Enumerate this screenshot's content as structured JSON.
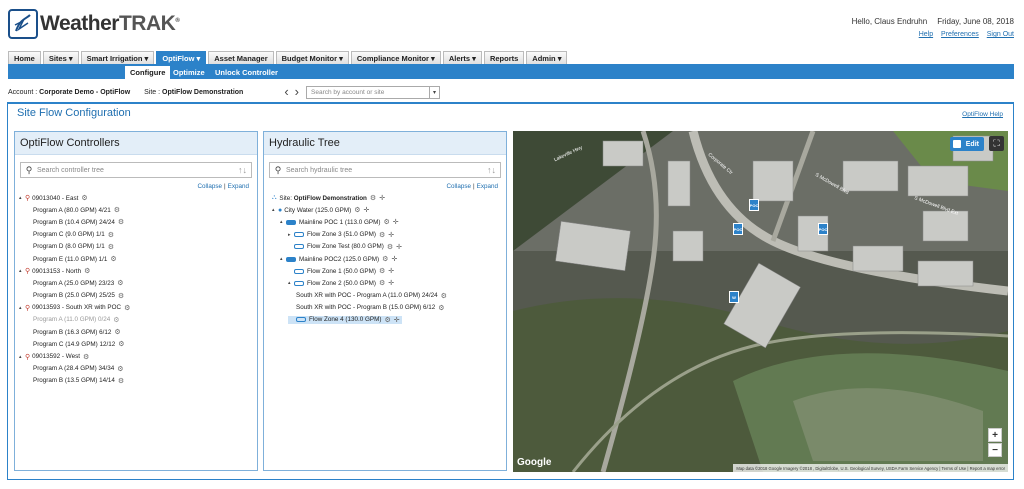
{
  "app": {
    "logo_text_a": "Weather",
    "logo_text_b": "TRAK",
    "logo_reg": "®"
  },
  "header": {
    "greeting": "Hello, Claus Endruhn",
    "date": "Friday, June 08, 2018",
    "links": [
      "Help",
      "Preferences",
      "Sign Out"
    ]
  },
  "nav": {
    "tabs": [
      "Home",
      "Sites ▾",
      "Smart Irrigation ▾",
      "OptiFlow ▾",
      "Asset Manager",
      "Budget Monitor ▾",
      "Compliance Monitor ▾",
      "Alerts ▾",
      "Reports",
      "Admin ▾"
    ],
    "active_index": 3
  },
  "subnav": {
    "items": [
      "Configure",
      "Optimize",
      "Unlock Controller"
    ],
    "active_index": 0
  },
  "account": {
    "label": "Account :",
    "value": "Corporate Demo - OptiFlow",
    "site_label": "Site :",
    "site_value": "OptiFlow Demonstration",
    "search_placeholder": "Search by account or site"
  },
  "page": {
    "title": "Site Flow Configuration",
    "help": "OptiFlow Help"
  },
  "controllers": {
    "title": "OptiFlow Controllers",
    "search_placeholder": "Search controller tree",
    "collapse": "Collapse",
    "expand": "Expand",
    "rows": [
      {
        "text": "09013040 - East",
        "level": 0
      },
      {
        "text": "Program A (80.0 GPM) 4/21",
        "level": 1
      },
      {
        "text": "Program B (10.4 GPM) 24/24",
        "level": 1
      },
      {
        "text": "Program C (9.0 GPM) 1/1",
        "level": 1
      },
      {
        "text": "Program D (8.0 GPM) 1/1",
        "level": 1
      },
      {
        "text": "Program E (11.0 GPM) 1/1",
        "level": 1
      },
      {
        "text": "09013153 - North",
        "level": 0
      },
      {
        "text": "Program A (25.0 GPM) 23/23",
        "level": 1
      },
      {
        "text": "Program B (25.0 GPM) 25/25",
        "level": 1
      },
      {
        "text": "09013593 - South XR with POC",
        "level": 0
      },
      {
        "text": "Program A (11.0 GPM) 0/24",
        "level": 1,
        "disabled": true
      },
      {
        "text": "Program B (16.3 GPM) 6/12",
        "level": 1
      },
      {
        "text": "Program C (14.9 GPM) 12/12",
        "level": 1
      },
      {
        "text": "09013592 - West",
        "level": 0
      },
      {
        "text": "Program A (28.4 GPM) 34/34",
        "level": 1
      },
      {
        "text": "Program B (13.5 GPM) 14/14",
        "level": 1
      }
    ]
  },
  "hydraulic": {
    "title": "Hydraulic Tree",
    "search_placeholder": "Search hydraulic tree",
    "collapse": "Collapse",
    "expand": "Expand",
    "site_label": "Site:",
    "site_name": "OptiFlow Demonstration",
    "rows": [
      {
        "text": "City Water (125.0 GPM)",
        "kind": "water",
        "level": 0
      },
      {
        "text": "Mainline POC 1 (113.0 GPM)",
        "kind": "main",
        "level": 1
      },
      {
        "text": "Flow Zone 3 (51.0 GPM)",
        "kind": "zone",
        "level": 2,
        "tog": "▸"
      },
      {
        "text": "Flow Zone Test (80.0 GPM)",
        "kind": "zone",
        "level": 2
      },
      {
        "text": "Mainline POC2 (125.0 GPM)",
        "kind": "main",
        "level": 1
      },
      {
        "text": "Flow Zone 1 (50.0 GPM)",
        "kind": "zone",
        "level": 2
      },
      {
        "text": "Flow Zone 2 (50.0 GPM)",
        "kind": "zone",
        "level": 2
      },
      {
        "text": "South XR with POC - Program A (11.0 GPM) 24/24",
        "kind": "prog",
        "level": 3
      },
      {
        "text": "South XR with POC - Program B (15.0 GPM) 6/12",
        "kind": "prog",
        "level": 3
      },
      {
        "text": "Flow Zone 4 (130.0 GPM)",
        "kind": "zone",
        "level": 2,
        "selected": true
      }
    ]
  },
  "map": {
    "edit": "Edit",
    "google": "Google",
    "attribution": "Map data ©2018 Google Imagery ©2018 , DigitalGlobe, U.S. Geological Survey, USDA Farm Service Agency | Terms of Use | Report a map error",
    "streets": [
      "Corporate Ctr",
      "S McDowell Blvd",
      "S McDowell Blvd Ext",
      "Lakeville Hwy"
    ],
    "markers": [
      "POC",
      "POC",
      "POC",
      "W"
    ]
  },
  "colors": {
    "brand": "#2c82c9",
    "header_bg": "#e3eef8"
  }
}
